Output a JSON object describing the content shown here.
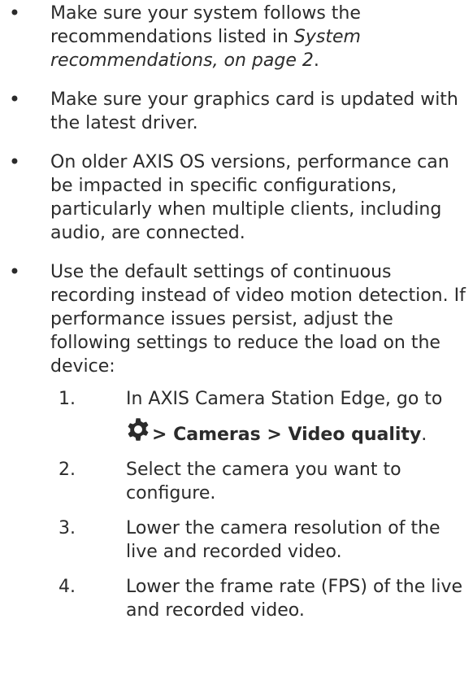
{
  "bullets": [
    {
      "pre": "Make sure your system follows the recommendations listed in ",
      "italic": "System recommendations, on page 2",
      "post": "."
    },
    {
      "text": "Make sure your graphics card is updated with the latest driver."
    },
    {
      "text": "On older AXIS OS versions, performance can be impacted in specific configurations, particularly when multiple clients, including audio, are connected."
    },
    {
      "text": "Use the default settings of continuous recording instead of video motion detection. If performance issues persist, adjust the following settings to reduce the load on the device:"
    }
  ],
  "bullet_symbol": "•",
  "steps": [
    {
      "number": "1.",
      "text": "In AXIS Camera Station Edge, go to",
      "icon": "gear-icon",
      "path": "> Cameras > Video quality",
      "path_suffix": "."
    },
    {
      "number": "2.",
      "text": "Select the camera you want to configure."
    },
    {
      "number": "3.",
      "text": "Lower the camera resolution of the live and recorded video."
    },
    {
      "number": "4.",
      "text": "Lower the frame rate (FPS) of the live and recorded video."
    }
  ],
  "colors": {
    "text": "#2b2b2b",
    "icon": "#2b2b2b",
    "background": "#ffffff"
  }
}
